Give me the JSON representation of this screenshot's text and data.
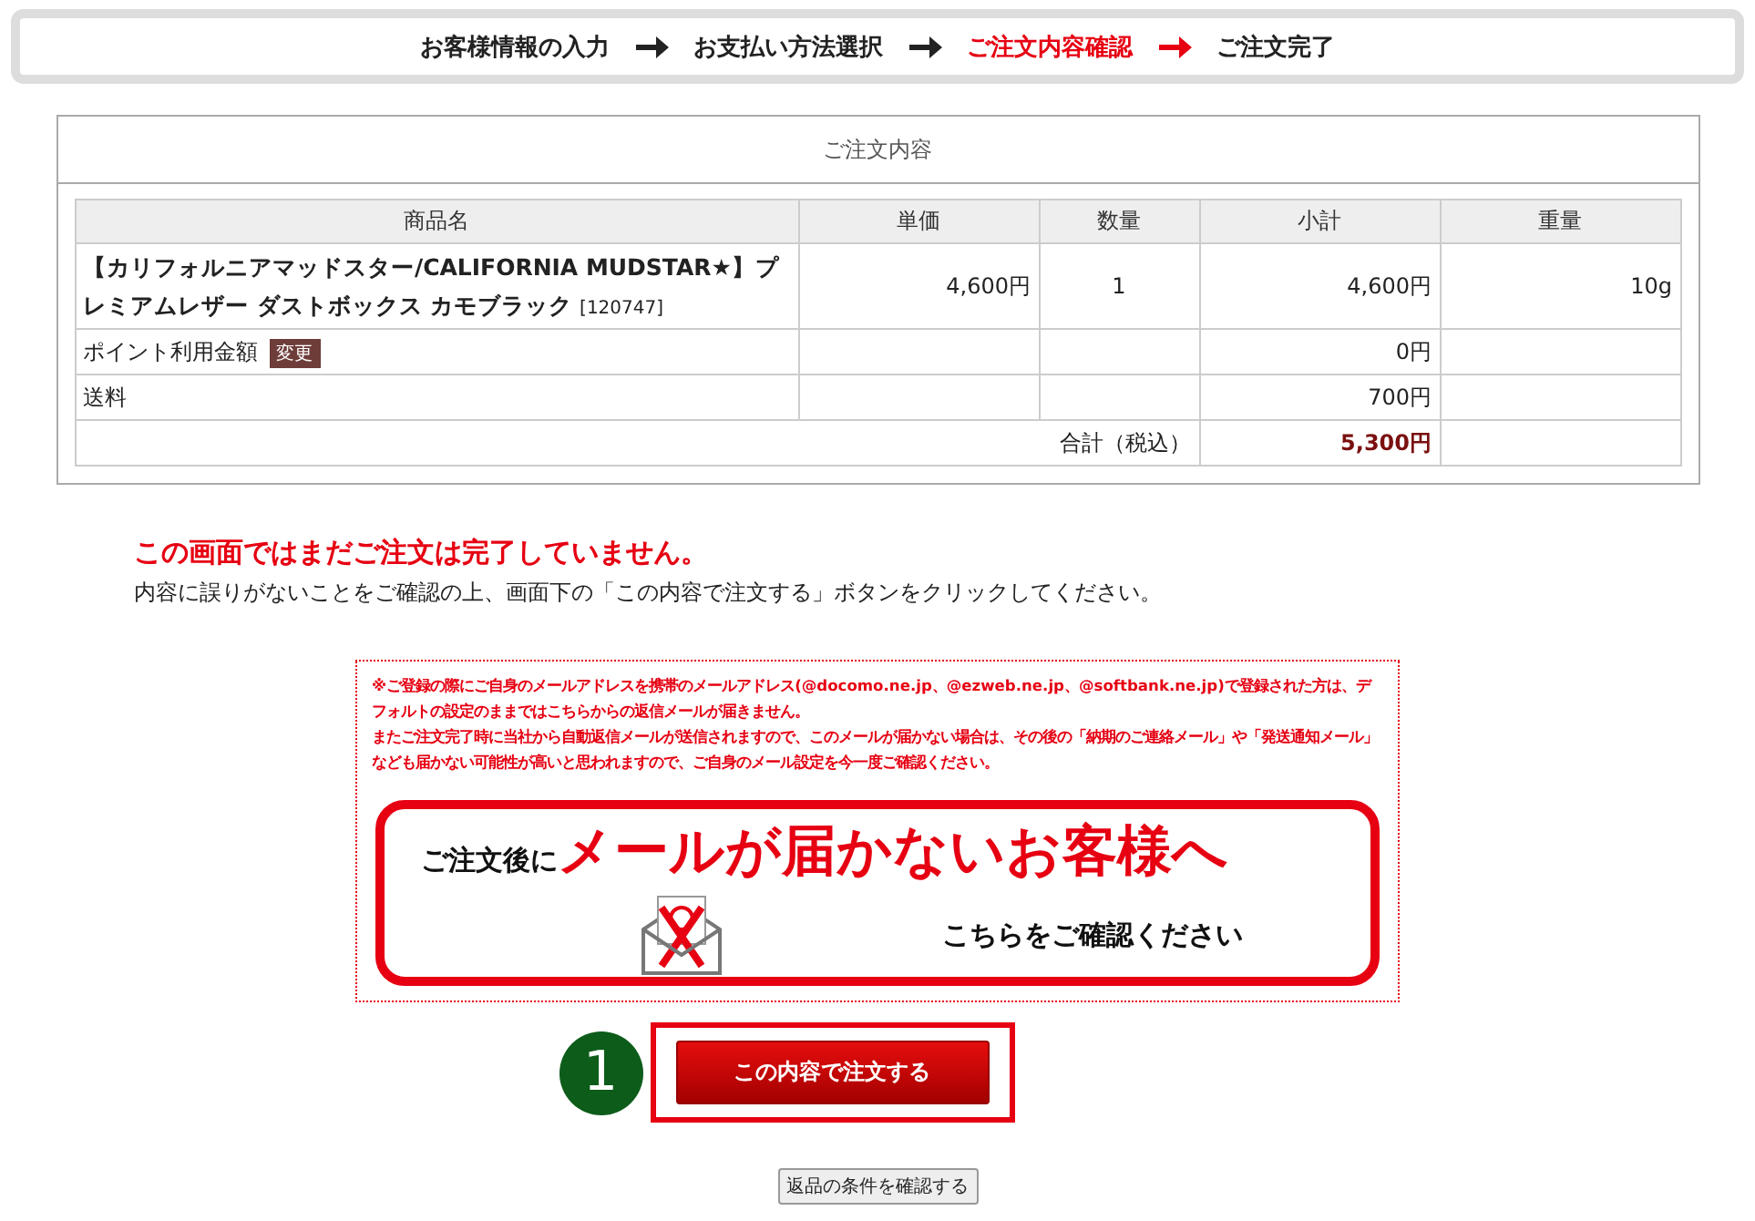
{
  "steps": [
    {
      "label": "お客様情報の入力",
      "selected": false
    },
    {
      "label": "お支払い方法選択",
      "selected": false
    },
    {
      "label": "ご注文内容確認",
      "selected": true
    },
    {
      "label": "ご注文完了",
      "selected": false
    }
  ],
  "order": {
    "title": "ご注文内容",
    "columns": [
      "商品名",
      "単価",
      "数量",
      "小計",
      "重量"
    ],
    "rows": [
      {
        "kind": "item",
        "name": "【カリフォルニアマッドスター/CALIFORNIA MUDSTAR★】プレミアムレザー ダストボックス カモブラック",
        "code": "[120747]",
        "price": "4,600円",
        "qty": "1",
        "subtotal": "4,600円",
        "weight": "10g"
      },
      {
        "kind": "points",
        "label": "ポイント利用金額",
        "action": "変更",
        "subtotal": "0円"
      },
      {
        "kind": "fee",
        "label": "送料",
        "subtotal": "700円"
      },
      {
        "kind": "total",
        "label": "合計（税込）",
        "subtotal": "5,300円"
      }
    ]
  },
  "warning": "この画面ではまだご注文は完了していません。",
  "instruction": "内容に誤りがないことをご確認の上、画面下の「この内容で注文する」ボタンをクリックしてください。",
  "notice": {
    "paragraphs": [
      "※ご登録の際にご自身のメールアドレスを携帯のメールアドレス(@docomo.ne.jp、@ezweb.ne.jp、@softbank.ne.jp)で登録された方は、デフォルトの設定のままではこちらからの返信メールが届きません。",
      "またご注文完了時に当社から自動返信メールが送信されますので、このメールが届かない場合は、その後の「納期のご連絡メール」や「発送通知メール」なども届かない可能性が高いと思われますので、ご自身のメール設定を今一度ご確認ください。"
    ],
    "banner": {
      "lead": "ご注文後に",
      "headline": "メールが届かないお客様へ",
      "link": "こちらをご確認ください"
    }
  },
  "annotation": "1",
  "submit": "この内容で注文する",
  "returns_button": "返品の条件を確認する"
}
